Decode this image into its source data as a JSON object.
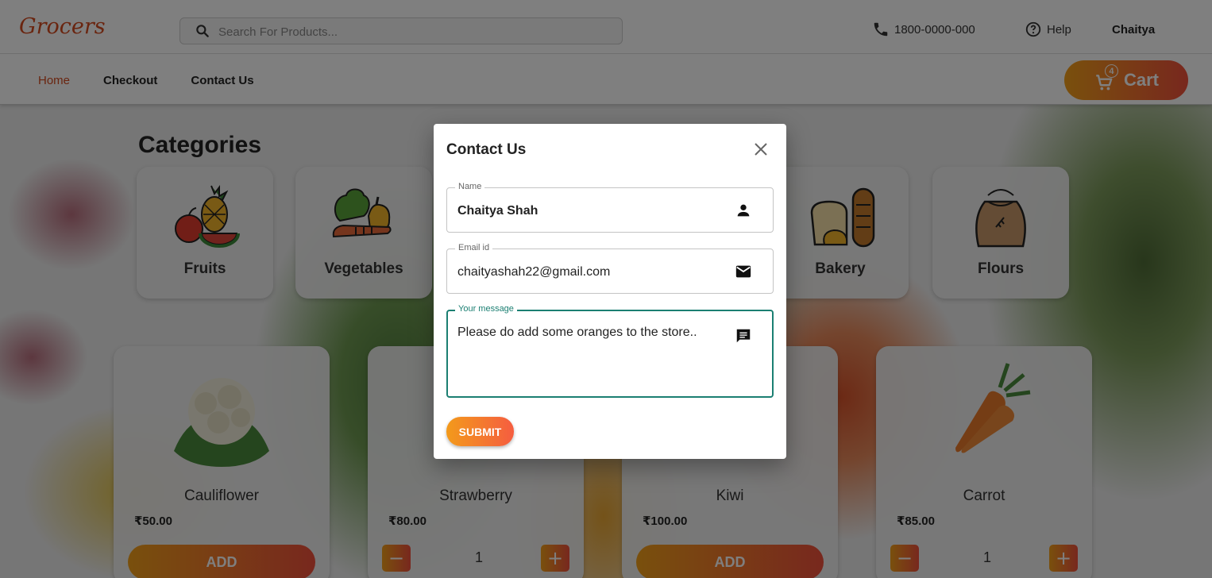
{
  "header": {
    "logo": "Grocers",
    "search_placeholder": "Search For Products...",
    "phone": "1800-0000-000",
    "help": "Help",
    "user": "Chaitya",
    "nav": [
      "Home",
      "Checkout",
      "Contact Us"
    ],
    "cart_label": "Cart",
    "cart_count": "4"
  },
  "categories": {
    "title": "Categories",
    "items": [
      "Fruits",
      "Vegetables",
      "Bakery",
      "Flours"
    ]
  },
  "products": [
    {
      "name": "Cauliflower",
      "price": "₹50.00",
      "action": "ADD"
    },
    {
      "name": "Strawberry",
      "price": "₹80.00",
      "qty": "1"
    },
    {
      "name": "Kiwi",
      "price": "₹100.00",
      "action": "ADD"
    },
    {
      "name": "Carrot",
      "price": "₹85.00",
      "qty": "1"
    }
  ],
  "modal": {
    "title": "Contact Us",
    "name_label": "Name",
    "name_value": "Chaitya Shah",
    "email_label": "Email id",
    "email_value": "chaityashah22@gmail.com",
    "message_label": "Your message",
    "message_value": "Please do add some oranges to the store..",
    "submit": "SUBMIT"
  },
  "colors": {
    "accent_start": "#f3a01a",
    "accent_end": "#f1503c",
    "brand": "#d44a1f",
    "focus": "#1b7f72"
  }
}
